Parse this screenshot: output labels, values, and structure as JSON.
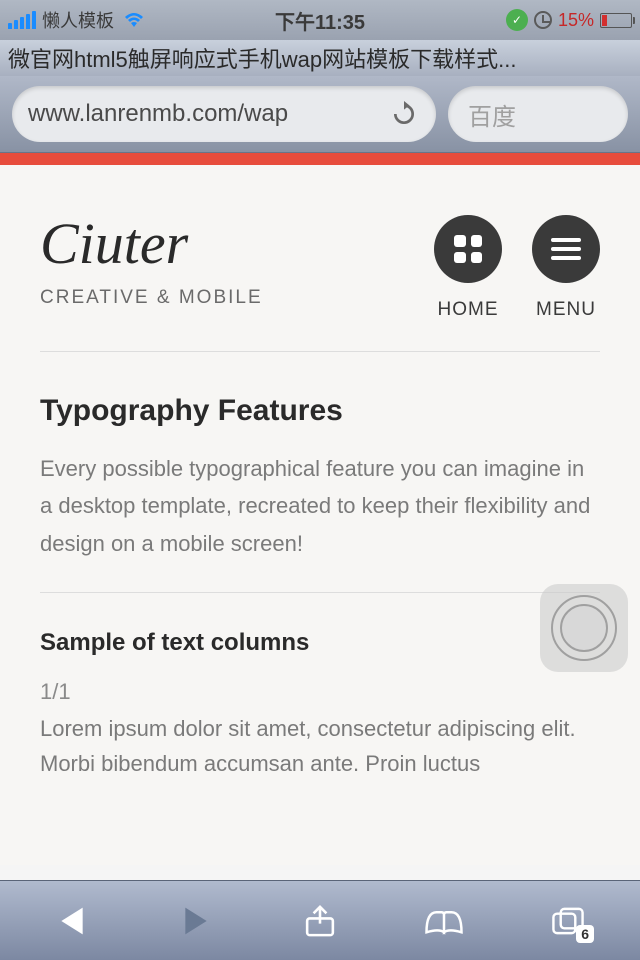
{
  "status": {
    "carrier": "懒人模板",
    "time": "下午11:35",
    "battery_pct": "15%"
  },
  "browser": {
    "page_title": "微官网html5触屏响应式手机wap网站模板下载样式...",
    "url": "www.lanrenmb.com/wap",
    "search_placeholder": "百度",
    "pages_count": "6"
  },
  "site": {
    "logo": "Ciuter",
    "tagline": "CREATIVE & MOBILE",
    "nav": {
      "home": "HOME",
      "menu": "MENU"
    }
  },
  "content": {
    "title": "Typography Features",
    "intro": "Every possible typographical feature you can imagine in a desktop template, recreated to keep their flexibility and design on a mobile screen!",
    "subtitle": "Sample of text columns",
    "col_label": "1/1",
    "col_body": "Lorem ipsum dolor sit amet, consectetur adipiscing elit. Morbi bibendum accumsan ante. Proin luctus"
  }
}
